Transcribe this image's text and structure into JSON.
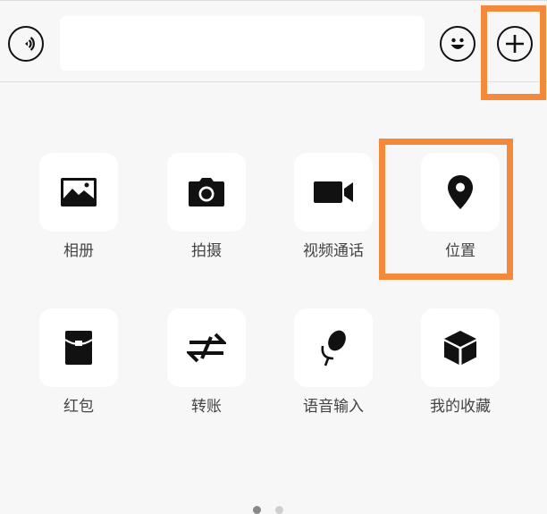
{
  "input_bar": {
    "text_value": "",
    "voice_icon": "voice-icon",
    "emoji_icon": "emoji-icon",
    "plus_icon": "plus-icon"
  },
  "panel": {
    "items": [
      {
        "label": "相册",
        "icon": "photo-album-icon"
      },
      {
        "label": "拍摄",
        "icon": "camera-icon"
      },
      {
        "label": "视频通话",
        "icon": "video-call-icon"
      },
      {
        "label": "位置",
        "icon": "location-pin-icon"
      },
      {
        "label": "红包",
        "icon": "red-envelope-icon"
      },
      {
        "label": "转账",
        "icon": "transfer-icon"
      },
      {
        "label": "语音输入",
        "icon": "microphone-icon"
      },
      {
        "label": "我的收藏",
        "icon": "favorites-cube-icon"
      }
    ]
  },
  "pager": {
    "page_count": 2,
    "current_page": 1
  },
  "colors": {
    "highlight": "#f5893a",
    "background": "#f7f7f7",
    "tile": "#ffffff",
    "icon": "#111111",
    "label": "#444444"
  }
}
